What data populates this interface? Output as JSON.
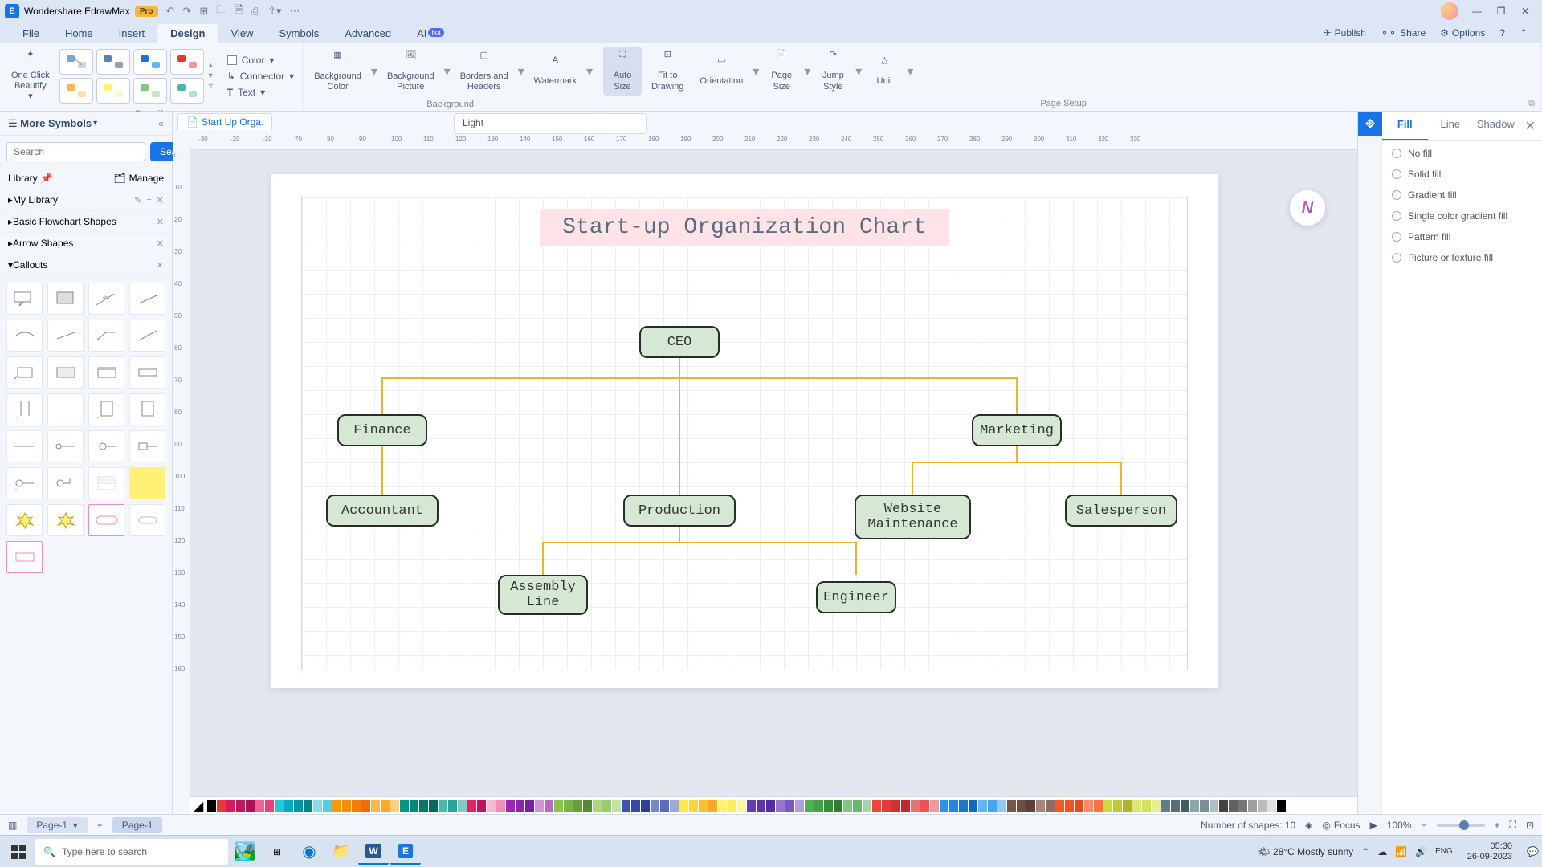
{
  "app": {
    "title": "Wondershare EdrawMax",
    "pro": "Pro"
  },
  "menu": {
    "file": "File",
    "home": "Home",
    "insert": "Insert",
    "design": "Design",
    "view": "View",
    "symbols": "Symbols",
    "advanced": "Advanced",
    "ai": "AI",
    "hot": "hot",
    "publish": "Publish",
    "share": "Share",
    "options": "Options"
  },
  "ribbon": {
    "oneclick": "One Click\nBeautify",
    "color": "Color",
    "connector": "Connector",
    "text": "Text",
    "bgcolor": "Background\nColor",
    "bgpic": "Background\nPicture",
    "borders": "Borders and\nHeaders",
    "watermark": "Watermark",
    "autosize": "Auto\nSize",
    "fit": "Fit to\nDrawing",
    "orientation": "Orientation",
    "pagesize": "Page\nSize",
    "jumpstyle": "Jump\nStyle",
    "unit": "Unit",
    "g_beautify": "Beautify",
    "g_background": "Background",
    "g_pagesetup": "Page Setup"
  },
  "doc": {
    "tab": "Start Up Orga.",
    "light": "Light"
  },
  "left": {
    "title": "More Symbols",
    "search_ph": "Search",
    "search_btn": "Search",
    "library": "Library",
    "manage": "Manage",
    "mylib": "My Library",
    "basic": "Basic Flowchart Shapes",
    "arrow": "Arrow Shapes",
    "callouts": "Callouts"
  },
  "chart": {
    "title": "Start-up Organization Chart",
    "ceo": "CEO",
    "finance": "Finance",
    "marketing": "Marketing",
    "accountant": "Accountant",
    "production": "Production",
    "website": "Website\nMaintenance",
    "sales": "Salesperson",
    "assembly": "Assembly\nLine",
    "engineer": "Engineer"
  },
  "right": {
    "fill": "Fill",
    "line": "Line",
    "shadow": "Shadow",
    "nofill": "No fill",
    "solid": "Solid fill",
    "gradient": "Gradient fill",
    "singlegrad": "Single color gradient fill",
    "pattern": "Pattern fill",
    "picture": "Picture or texture fill"
  },
  "status": {
    "page": "Page-1",
    "page2": "Page-1",
    "shapes": "Number of shapes: 10",
    "focus": "Focus",
    "zoom": "100%"
  },
  "taskbar": {
    "search": "Type here to search",
    "weather": "28°C  Mostly sunny",
    "time": "05:30",
    "date": "26-09-2023"
  },
  "ruler_h": [
    "-30",
    "-20",
    "-10",
    "70",
    "80",
    "90",
    "100",
    "110",
    "120",
    "130",
    "140",
    "150",
    "160",
    "170",
    "180",
    "190",
    "200",
    "210",
    "220",
    "230",
    "240",
    "250",
    "260",
    "270",
    "280",
    "290",
    "300",
    "310",
    "320",
    "330"
  ],
  "ruler_v": [
    "0",
    "10",
    "20",
    "30",
    "40",
    "50",
    "60",
    "70",
    "80",
    "90",
    "100",
    "110",
    "120",
    "130",
    "140",
    "150",
    "160"
  ],
  "colors": [
    "#000",
    "#e53935",
    "#d81b60",
    "#c2185b",
    "#ad1457",
    "#f06292",
    "#ec407a",
    "#26c6da",
    "#00acc1",
    "#0097a7",
    "#00838f",
    "#80deea",
    "#4dd0e1",
    "#ff9800",
    "#fb8c00",
    "#f57c00",
    "#ef6c00",
    "#ffb74d",
    "#ffa726",
    "#ffcc80",
    "#009688",
    "#00897b",
    "#00796b",
    "#00695c",
    "#4db6ac",
    "#26a69a",
    "#80cbc4",
    "#e91e63",
    "#c51162",
    "#f8bbd0",
    "#f48fb1",
    "#9c27b0",
    "#8e24aa",
    "#7b1fa2",
    "#ce93d8",
    "#ba68c8",
    "#8bc34a",
    "#7cb342",
    "#689f38",
    "#558b2f",
    "#aed581",
    "#9ccc65",
    "#c5e1a5",
    "#3f51b5",
    "#3949ab",
    "#303f9f",
    "#7986cb",
    "#5c6bc0",
    "#9fa8da",
    "#ffeb3b",
    "#fdd835",
    "#fbc02d",
    "#f9a825",
    "#fff176",
    "#ffee58",
    "#fff59d",
    "#673ab7",
    "#5e35b1",
    "#512da8",
    "#9575cd",
    "#7e57c2",
    "#b39ddb",
    "#4caf50",
    "#43a047",
    "#388e3c",
    "#2e7d32",
    "#81c784",
    "#66bb6a",
    "#a5d6a7",
    "#f44336",
    "#e53935",
    "#d32f2f",
    "#c62828",
    "#e57373",
    "#ef5350",
    "#ef9a9a",
    "#2196f3",
    "#1e88e5",
    "#1976d2",
    "#1565c0",
    "#64b5f6",
    "#42a5f5",
    "#90caf9",
    "#795548",
    "#6d4c41",
    "#5d4037",
    "#a1887f",
    "#8d6e63",
    "#ff5722",
    "#f4511e",
    "#e64a19",
    "#ff8a65",
    "#ff7043",
    "#cddc39",
    "#c0ca33",
    "#afb42b",
    "#dce775",
    "#d4e157",
    "#e6ee9c",
    "#607d8b",
    "#546e7a",
    "#455a64",
    "#90a4ae",
    "#78909c",
    "#b0bec5",
    "#424242",
    "#616161",
    "#757575",
    "#9e9e9e",
    "#bdbdbd",
    "#e0e0e0",
    "#000",
    "#fff"
  ]
}
